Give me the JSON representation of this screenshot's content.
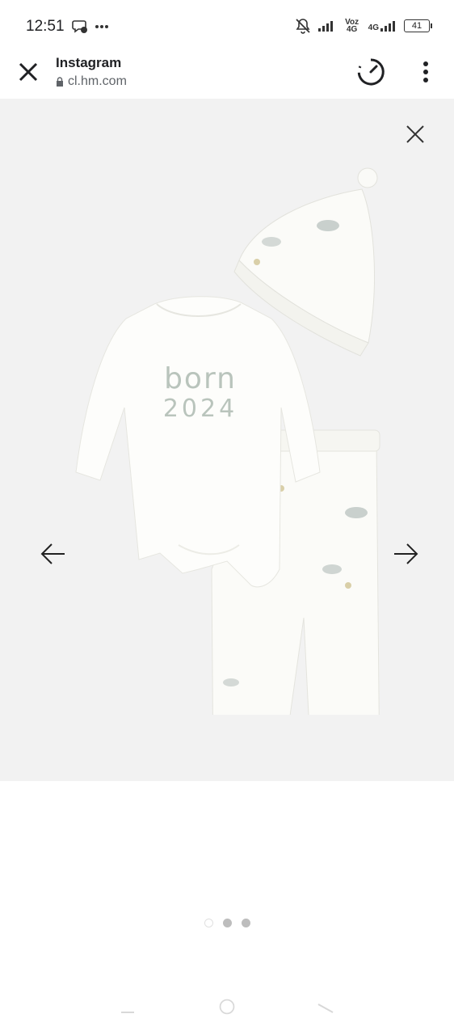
{
  "status_bar": {
    "time": "12:51",
    "volte_label": "Voz 4G",
    "net_label": "4G",
    "battery": "41"
  },
  "browser": {
    "title": "Instagram",
    "url": "cl.hm.com"
  },
  "product_print": {
    "line1": "born",
    "line2": "2024"
  },
  "pagination": {
    "total": 3,
    "active_index": 0
  },
  "colors": {
    "gallery_bg": "#f2f2f2",
    "text_primary": "#202124",
    "text_secondary": "#5f6368"
  }
}
